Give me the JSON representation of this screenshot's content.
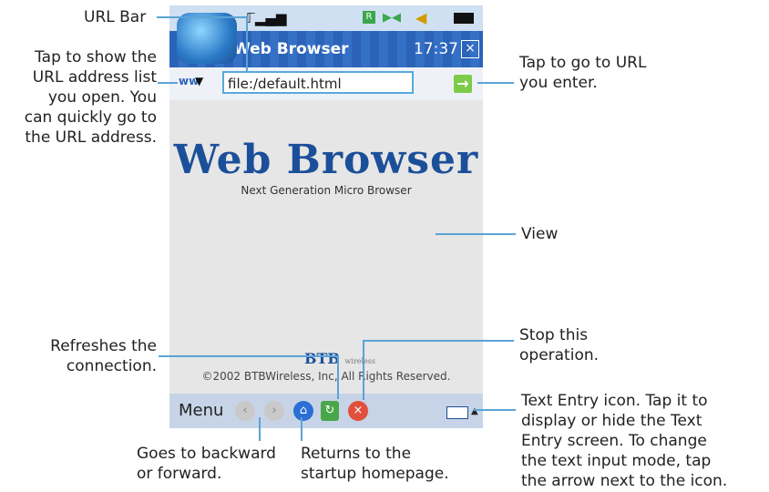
{
  "screen": {
    "app_title": "Web Browser",
    "clock": "17:37",
    "url_value": "file:/default.html",
    "banner_title": "Web Browser",
    "banner_subtitle": "Next Generation Micro Browser",
    "footer_logo": "BTB",
    "footer_logo_small": "wireless",
    "copyright": "©2002 BTBWireless, Inc, All Rights Reserved.",
    "menu_label": "Menu"
  },
  "callouts": {
    "url_bar": "URL Bar",
    "address_list": [
      "Tap to show the",
      "URL address list",
      "you open. You",
      "can quickly go to",
      "the URL address."
    ],
    "go_url": [
      "Tap to go to URL",
      "you enter."
    ],
    "view": "View",
    "refresh": [
      "Refreshes the",
      "connection."
    ],
    "stop": [
      "Stop this",
      "operation."
    ],
    "text_entry": [
      "Text Entry icon. Tap it to",
      "display or hide the Text",
      "Entry screen. To change",
      "the text input mode, tap",
      "the arrow next to the icon."
    ],
    "back_forward": [
      "Goes to backward",
      "or forward."
    ],
    "home": [
      "Returns to the",
      "startup homepage."
    ]
  },
  "icons": [
    "signal-icon",
    "message-icon",
    "speaker-icon",
    "battery-icon",
    "close-icon",
    "dropdown-arrow-icon",
    "go-icon",
    "back-icon",
    "forward-icon",
    "home-icon",
    "refresh-icon",
    "stop-icon",
    "keyboard-icon"
  ]
}
